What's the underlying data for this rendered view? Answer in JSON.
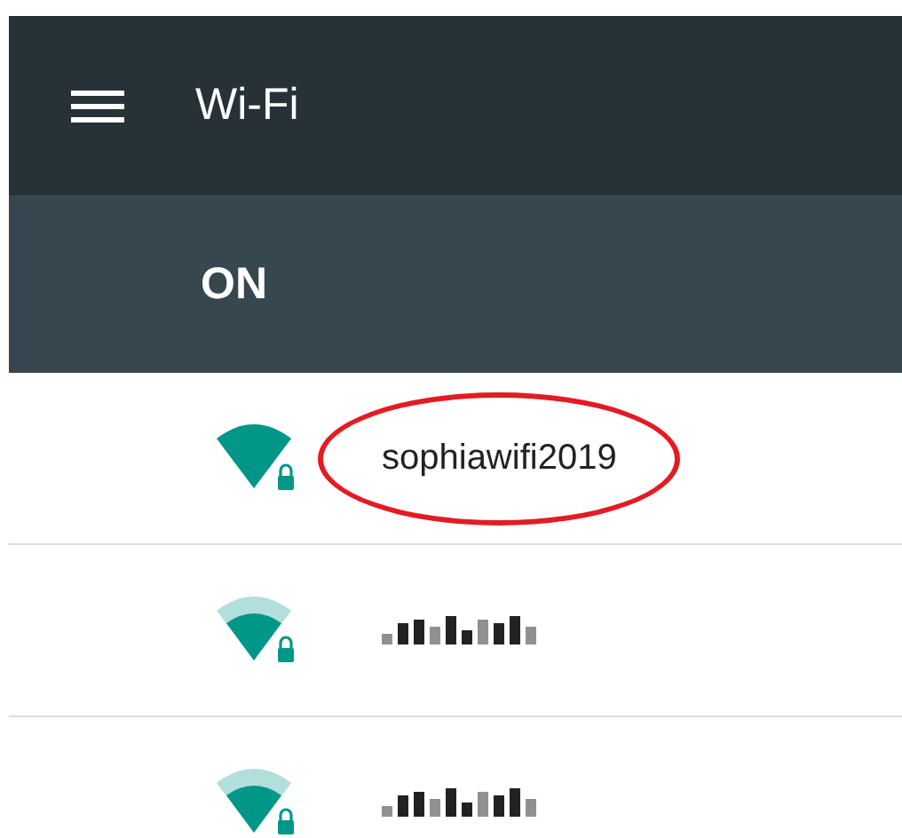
{
  "app_bar": {
    "title": "Wi-Fi"
  },
  "switch_bar": {
    "label": "ON"
  },
  "networks": [
    {
      "name": "sophiawifi2019",
      "kind": "strong",
      "locked": true,
      "redacted": false,
      "highlighted": true
    },
    {
      "kind": "medium",
      "locked": true,
      "redacted": true,
      "highlighted": false
    },
    {
      "kind": "medium",
      "locked": true,
      "redacted": true,
      "highlighted": false
    }
  ]
}
